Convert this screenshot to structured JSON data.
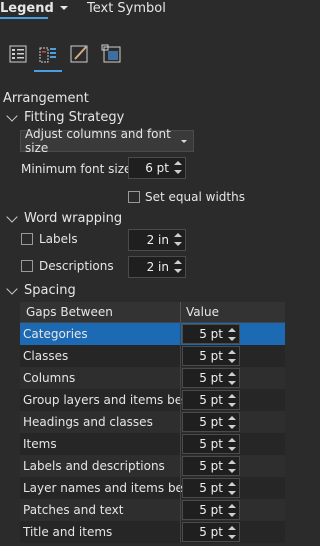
{
  "tabs": {
    "active": "Legend",
    "other": "Text Symbol"
  },
  "icons": [
    "legend-items-icon",
    "arrangement-icon",
    "display-icon",
    "placement-icon"
  ],
  "arrangement": {
    "title": "Arrangement",
    "fitting": {
      "title": "Fitting Strategy",
      "strategy": "Adjust columns and font size",
      "min_font_label": "Minimum font size",
      "min_font_value": "6 pt",
      "equal_widths_label": "Set equal widths"
    },
    "wrapping": {
      "title": "Word wrapping",
      "labels_label": "Labels",
      "labels_value": "2 in",
      "desc_label": "Descriptions",
      "desc_value": "2 in"
    },
    "spacing": {
      "title": "Spacing",
      "col_gap": "Gaps Between",
      "col_value": "Value",
      "rows": [
        {
          "name": "Categories",
          "value": "5 pt"
        },
        {
          "name": "Classes",
          "value": "5 pt"
        },
        {
          "name": "Columns",
          "value": "5 pt"
        },
        {
          "name": "Group layers and items below",
          "value": "5 pt"
        },
        {
          "name": "Headings and classes",
          "value": "5 pt"
        },
        {
          "name": "Items",
          "value": "5 pt"
        },
        {
          "name": "Labels and descriptions",
          "value": "5 pt"
        },
        {
          "name": "Layer names and items below",
          "value": "5 pt"
        },
        {
          "name": "Patches and text",
          "value": "5 pt"
        },
        {
          "name": "Title and items",
          "value": "5 pt"
        }
      ]
    }
  },
  "colors": {
    "background": "#2b2b2b",
    "accent": "#4a9fe0",
    "selection": "#1c6ab4"
  }
}
